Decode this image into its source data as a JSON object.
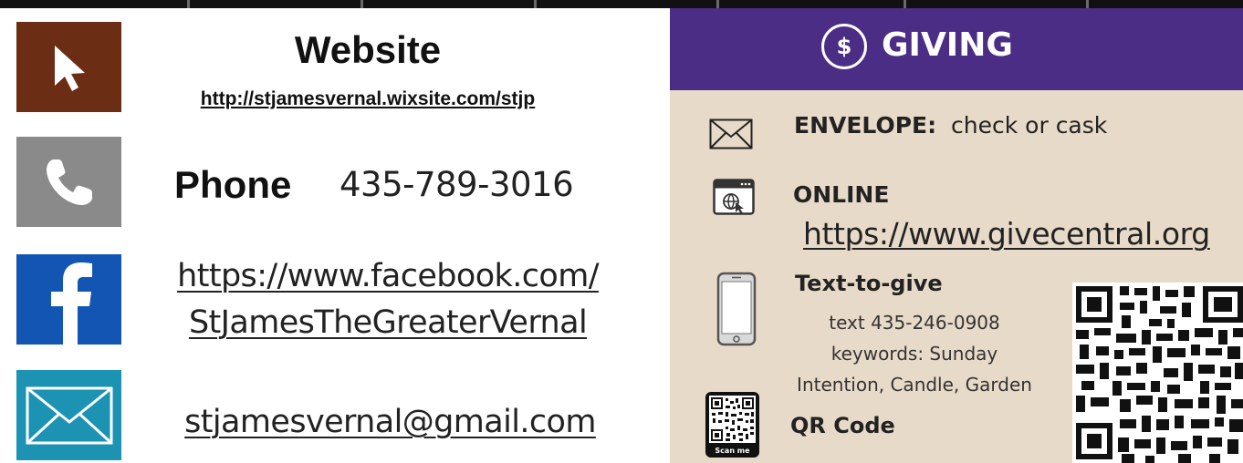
{
  "colors": {
    "website_tile": "#6b2e15",
    "phone_tile": "#8a8a8a",
    "facebook_tile": "#1255b3",
    "mail_tile": "#1d93b3",
    "giving_header": "#4b2d86",
    "giving_panel": "#e8dac8"
  },
  "contact": {
    "website": {
      "title": "Website",
      "url": "http://stjamesvernal.wixsite.com/stjp",
      "icon": "cursor-icon"
    },
    "phone": {
      "label": "Phone",
      "number": "435-789-3016",
      "icon": "phone-icon"
    },
    "facebook": {
      "line1": "https://www.facebook.com/",
      "line2": "StJamesTheGreaterVernal",
      "icon": "facebook-icon"
    },
    "email": {
      "address": "stjamesvernal@gmail.com",
      "icon": "mail-icon"
    }
  },
  "giving": {
    "symbol": "$",
    "title": "GIVING",
    "envelope": {
      "label": "ENVELOPE:",
      "text": "check or cask",
      "icon": "envelope-icon"
    },
    "online": {
      "label": "ONLINE",
      "url": "https://www.givecentral.org",
      "icon": "browser-icon"
    },
    "text_to_give": {
      "title": "Text-to-give",
      "line1": "text 435-246-0908",
      "line2": "keywords: Sunday",
      "line3": "Intention, Candle, Garden",
      "icon": "smartphone-icon"
    },
    "qr": {
      "label": "QR Code",
      "scan_label": "Scan me",
      "icon": "qr-code-icon"
    }
  }
}
